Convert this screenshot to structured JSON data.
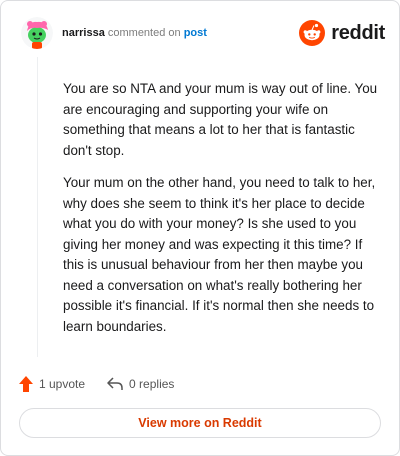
{
  "header": {
    "username": "narrissa",
    "action_text": "commented on",
    "target_text": "post",
    "brand_word": "reddit"
  },
  "comment": {
    "paragraphs": [
      "You are so NTA and your mum is way out of line. You are encouraging and supporting your wife on something that means a lot to her that is fantastic don't stop.",
      "Your mum on the other hand, you need to talk to her, why does she seem to think it's her place to decide what you do with your money? Is she used to you giving her money and was expecting it this time? If this is unusual behaviour from her then maybe you need a conversation on what's really bothering her possible it's financial. If it's normal then she needs to learn boundaries."
    ]
  },
  "actions": {
    "upvote_label": "1 upvote",
    "replies_label": "0 replies"
  },
  "footer": {
    "view_button_label": "View more on Reddit"
  },
  "colors": {
    "brand_orange": "#ff4500",
    "link_blue": "#0079d3",
    "button_text": "#d93a00",
    "border": "#dcdde0"
  },
  "icons": {
    "avatar": "snoo-avatar-icon",
    "logo": "reddit-alien-icon",
    "upvote": "upvote-arrow-icon",
    "reply": "reply-arrow-icon"
  }
}
